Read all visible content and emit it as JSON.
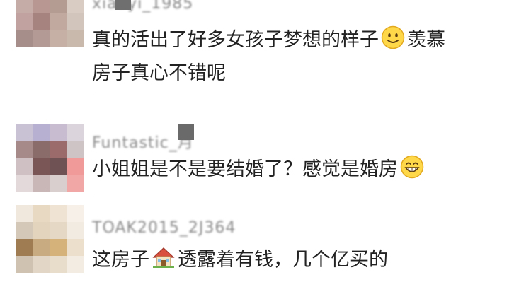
{
  "comments": [
    {
      "username": "xiaoyi_1985",
      "line1_before": "真的活出了好多女孩子梦想的样子",
      "line1_emoji": "smile-emoji",
      "line1_after": "羡慕",
      "line2": "房子真心不错呢"
    },
    {
      "username": "Funtastic_月",
      "line1_before": "小姐姐是不是要结婚了？感觉是婚房",
      "line1_emoji": "grin-emoji"
    },
    {
      "username": "TOAK2015_2J364",
      "line1_before": "这房子",
      "line1_emoji": "house-emoji",
      "line1_after": "透露着有钱，几个亿买的"
    }
  ]
}
